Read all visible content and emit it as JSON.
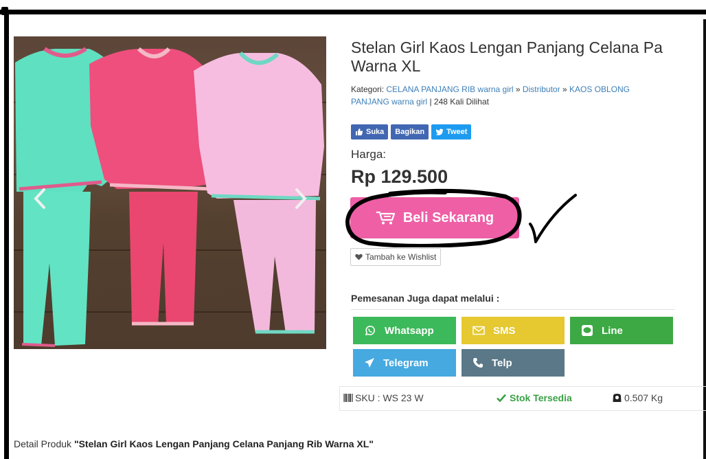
{
  "product": {
    "title_line1": "Stelan Girl Kaos Lengan Panjang Celana Pa",
    "title_line2": "Warna XL",
    "kategori_label": "Kategori:",
    "kategori_1": "CELANA PANJANG RIB warna girl",
    "sep": "»",
    "kategori_2": "Distributor",
    "kategori_3": "KAOS OBLONG",
    "kategori_3b": "PANJANG warna girl",
    "views": "| 248 Kali Dilihat",
    "harga_label": "Harga:",
    "price": "Rp 129.500"
  },
  "social": {
    "like": "Suka",
    "share": "Bagikan",
    "tweet": "Tweet"
  },
  "actions": {
    "buy": "Beli Sekarang",
    "wishlist": "Tambah ke Wishlist"
  },
  "order": {
    "heading": "Pemesanan Juga dapat melalui :",
    "whatsapp": "Whatsapp",
    "sms": "SMS",
    "line": "Line",
    "telegram": "Telegram",
    "telp": "Telp"
  },
  "info": {
    "sku": "SKU : WS 23 W",
    "stock": "Stok Tersedia",
    "weight": "0.507 Kg"
  },
  "detail": {
    "prefix": "Detail Produk",
    "name": "\"Stelan Girl Kaos Lengan Panjang Celana Panjang Rib Warna XL\""
  },
  "colors": {
    "buy_button": "#ee5fa6",
    "whatsapp": "#3cb95a",
    "sms": "#e6c830",
    "line": "#3da944",
    "telegram": "#46a9e0",
    "telp": "#5a7887",
    "link": "#3c7fb8"
  },
  "icons": [
    "thumbs-up-icon",
    "twitter-bird-icon",
    "cart-icon",
    "heart-icon",
    "whatsapp-icon",
    "envelope-icon",
    "line-chat-icon",
    "paper-plane-icon",
    "phone-icon",
    "barcode-icon",
    "check-icon",
    "weight-icon",
    "chevron-left-icon",
    "chevron-right-icon"
  ]
}
